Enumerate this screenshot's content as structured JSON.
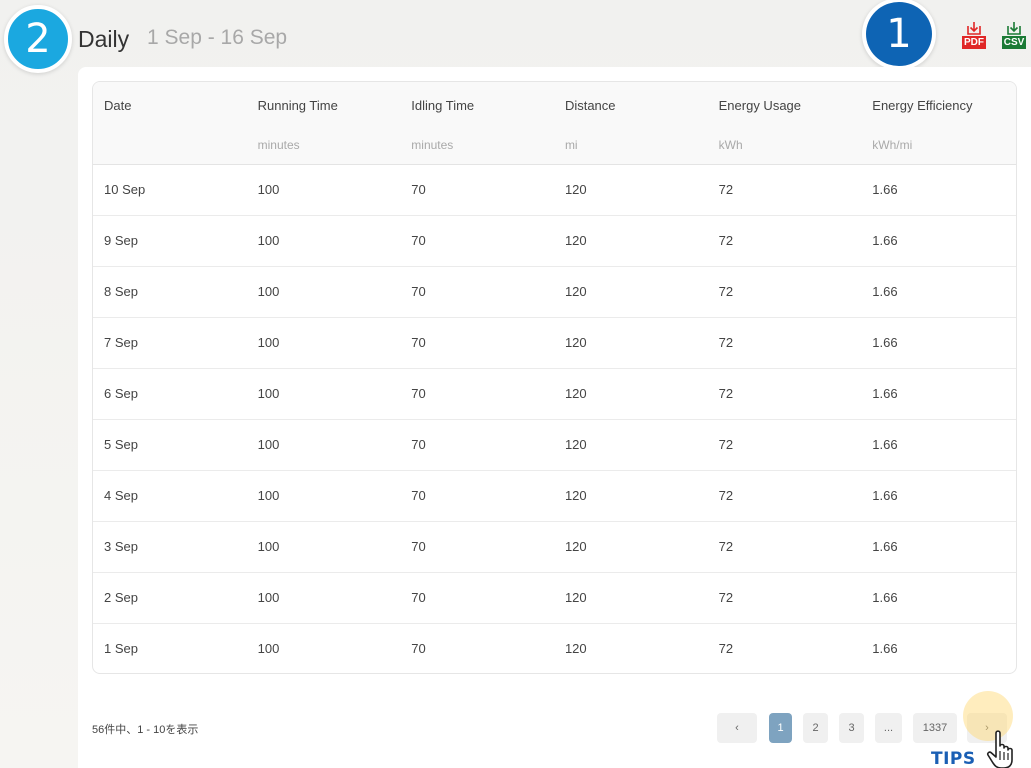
{
  "header": {
    "title": "Daily",
    "date_range": "1 Sep - 16 Sep"
  },
  "badges": {
    "left": "2",
    "right": "1"
  },
  "export": {
    "pdf_label": "PDF",
    "csv_label": "CSV",
    "pdf_color": "#e02727",
    "csv_color": "#1b7a35"
  },
  "table": {
    "headers": [
      "Date",
      "Running Time",
      "Idling Time",
      "Distance",
      "Energy Usage",
      "Energy Efficiency"
    ],
    "units": [
      "",
      "minutes",
      "minutes",
      "mi",
      "kWh",
      "kWh/mi"
    ],
    "rows": [
      [
        "10 Sep",
        "100",
        "70",
        "120",
        "72",
        "1.66"
      ],
      [
        "9 Sep",
        "100",
        "70",
        "120",
        "72",
        "1.66"
      ],
      [
        "8 Sep",
        "100",
        "70",
        "120",
        "72",
        "1.66"
      ],
      [
        "7 Sep",
        "100",
        "70",
        "120",
        "72",
        "1.66"
      ],
      [
        "6 Sep",
        "100",
        "70",
        "120",
        "72",
        "1.66"
      ],
      [
        "5 Sep",
        "100",
        "70",
        "120",
        "72",
        "1.66"
      ],
      [
        "4 Sep",
        "100",
        "70",
        "120",
        "72",
        "1.66"
      ],
      [
        "3 Sep",
        "100",
        "70",
        "120",
        "72",
        "1.66"
      ],
      [
        "2 Sep",
        "100",
        "70",
        "120",
        "72",
        "1.66"
      ],
      [
        "1 Sep",
        "100",
        "70",
        "120",
        "72",
        "1.66"
      ]
    ]
  },
  "pagination": {
    "summary": "56件中、1 - 10を表示",
    "prev": "‹",
    "pages": [
      "1",
      "2",
      "3"
    ],
    "ellipsis": "...",
    "last": "1337",
    "next": "›",
    "current_page": "1"
  },
  "overlay": {
    "tips_label": "TIPS"
  }
}
